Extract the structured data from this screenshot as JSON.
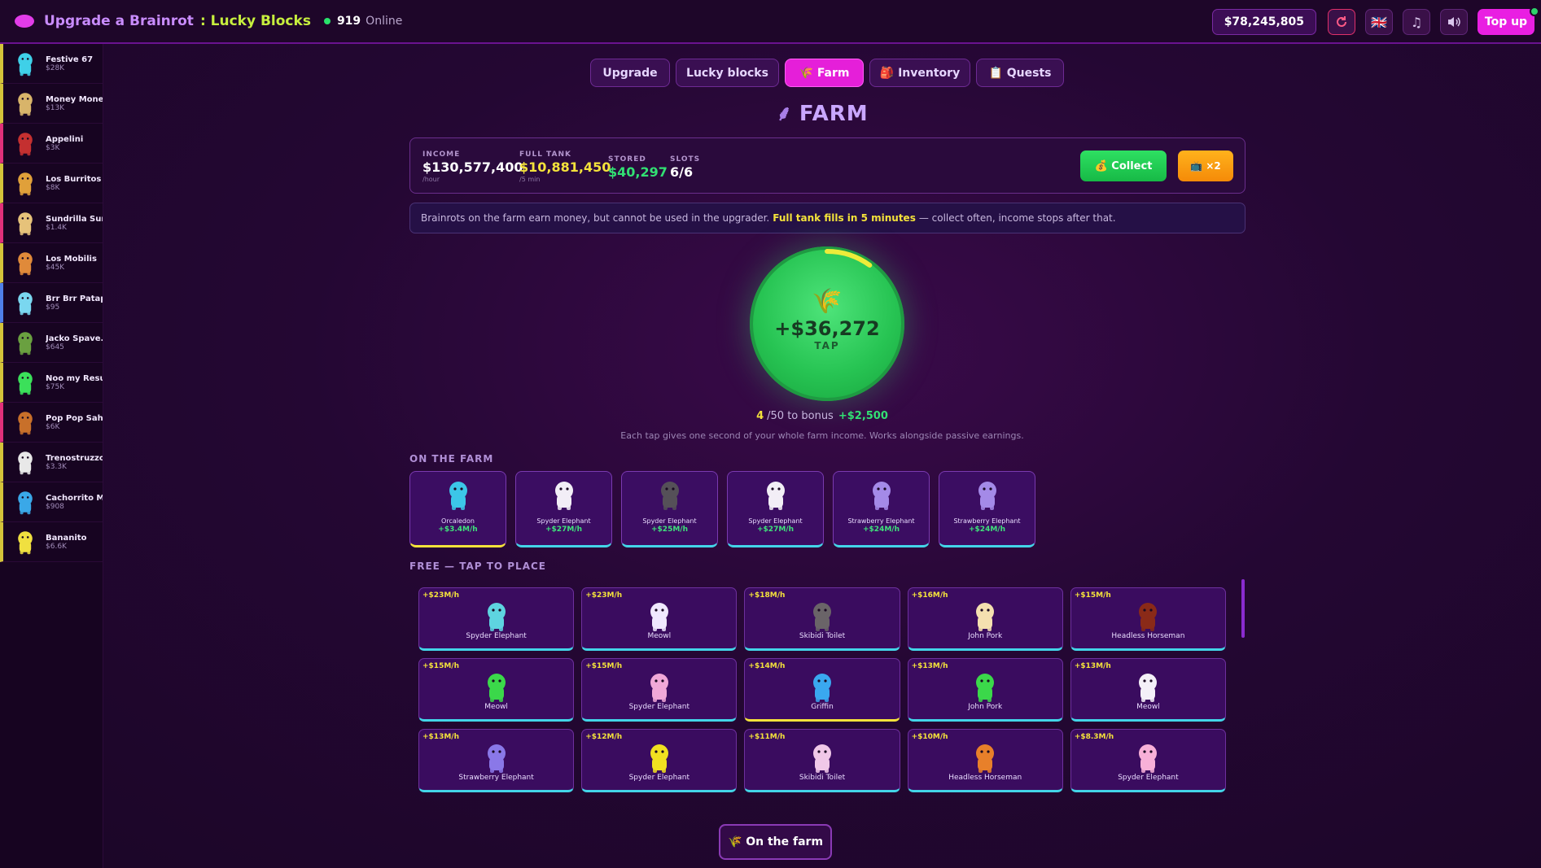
{
  "header": {
    "title": "Upgrade a Brainrot",
    "subtitle": ": Lucky Blocks",
    "online_count": "919",
    "online_label": "Online",
    "balance": "$78,245,805",
    "topup_label": "Top up",
    "flag": "🇬🇧",
    "icons": [
      "refresh-icon",
      "flag-uk-icon",
      "music-icon",
      "sound-icon"
    ]
  },
  "sidebar": {
    "items": [
      {
        "name": "Festive 67",
        "price": "$28K",
        "color": "#3fd0e8"
      },
      {
        "name": "Money Mone...",
        "price": "$13K",
        "color": "#d8b46a"
      },
      {
        "name": "Appelini",
        "price": "$3K",
        "color": "#c43030"
      },
      {
        "name": "Los Burritos",
        "price": "$8K",
        "color": "#e0a03a"
      },
      {
        "name": "Sundrilla Sun...",
        "price": "$1.4K",
        "color": "#e6c27a"
      },
      {
        "name": "Los Mobilis",
        "price": "$45K",
        "color": "#e08a3a"
      },
      {
        "name": "Brr Brr Patap...",
        "price": "$95",
        "color": "#7ad7f0"
      },
      {
        "name": "Jacko Spave...",
        "price": "$645",
        "color": "#6aa040"
      },
      {
        "name": "Noo my Resu...",
        "price": "$75K",
        "color": "#3be05a"
      },
      {
        "name": "Pop Pop Sahur",
        "price": "$6K",
        "color": "#c8702a"
      },
      {
        "name": "Trenostruzzo...",
        "price": "$3.3K",
        "color": "#e8e8e8"
      },
      {
        "name": "Cachorrito M...",
        "price": "$908",
        "color": "#3aa8e8"
      },
      {
        "name": "Bananito",
        "price": "$6.6K",
        "color": "#f0e040"
      }
    ]
  },
  "tabs": [
    {
      "label": "Upgrade",
      "icon": ""
    },
    {
      "label": "Lucky blocks",
      "icon": ""
    },
    {
      "label": "Farm",
      "icon": "🌾",
      "active": true
    },
    {
      "label": "Inventory",
      "icon": "🎒"
    },
    {
      "label": "Quests",
      "icon": "📋"
    }
  ],
  "farm": {
    "heading": "FARM",
    "stats": {
      "income_label": "INCOME",
      "income_value": "$130,577,400",
      "income_unit": "/hour",
      "tank_label": "FULL TANK",
      "tank_value": "$10,881,450",
      "tank_unit": "/5 min",
      "stored_label": "STORED",
      "stored_value": "$40,297",
      "slots_label": "SLOTS",
      "slots_value": "6/6"
    },
    "collect_label": "Collect",
    "collect_icon": "💰",
    "x2_label": "×2",
    "x2_icon": "📺",
    "info_prefix": "Brainrots on the farm earn money, but cannot be used in the upgrader.",
    "info_bold": "Full tank fills in 5 minutes",
    "info_suffix": "— collect often, income stops after that.",
    "tap_amount": "+$36,272",
    "tap_label": "TAP",
    "tap_progress": 0.1,
    "bonus_current": "4",
    "bonus_total": "/50 to bonus",
    "bonus_reward": "+$2,500",
    "bonus_note": "Each tap gives one second of your whole farm income. Works alongside passive earnings.",
    "on_farm_title": "ON THE FARM",
    "free_title": "FREE — TAP TO PLACE",
    "on_farm_button": "On the farm",
    "on_farm_button_icon": "🌾"
  },
  "on_farm": [
    {
      "name": "Orcaledon",
      "income": "+$3.4M/h",
      "color": "#3cc6e8",
      "gold": true
    },
    {
      "name": "Spyder Elephant",
      "income": "+$27M/h",
      "color": "#f2eef6"
    },
    {
      "name": "Spyder Elephant",
      "income": "+$25M/h",
      "color": "#555058"
    },
    {
      "name": "Spyder Elephant",
      "income": "+$27M/h",
      "color": "#f2eef6"
    },
    {
      "name": "Strawberry Elephant",
      "income": "+$24M/h",
      "color": "#a48ae8"
    },
    {
      "name": "Strawberry Elephant",
      "income": "+$24M/h",
      "color": "#a48ae8"
    }
  ],
  "free": [
    {
      "rate": "+$23M/h",
      "name": "Spyder Elephant",
      "color": "#5ed4e0"
    },
    {
      "rate": "+$23M/h",
      "name": "Meowl",
      "color": "#f0e8ff"
    },
    {
      "rate": "+$18M/h",
      "name": "Skibidi Toilet",
      "color": "#6a6468"
    },
    {
      "rate": "+$16M/h",
      "name": "John Pork",
      "color": "#f4e0b0"
    },
    {
      "rate": "+$15M/h",
      "name": "Headless Horseman",
      "color": "#8a2a18"
    },
    {
      "rate": "+$15M/h",
      "name": "Meowl",
      "color": "#3bd84a"
    },
    {
      "rate": "+$15M/h",
      "name": "Spyder Elephant",
      "color": "#f0a8d8"
    },
    {
      "rate": "+$14M/h",
      "name": "Griffin",
      "color": "#3aa8f0",
      "gold": true
    },
    {
      "rate": "+$13M/h",
      "name": "John Pork",
      "color": "#3bd84a"
    },
    {
      "rate": "+$13M/h",
      "name": "Meowl",
      "color": "#f4f0f8"
    },
    {
      "rate": "+$13M/h",
      "name": "Strawberry Elephant",
      "color": "#8a78e8"
    },
    {
      "rate": "+$12M/h",
      "name": "Spyder Elephant",
      "color": "#f0e020"
    },
    {
      "rate": "+$11M/h",
      "name": "Skibidi Toilet",
      "color": "#f0c8e8"
    },
    {
      "rate": "+$10M/h",
      "name": "Headless Horseman",
      "color": "#e8802a"
    },
    {
      "rate": "+$8.3M/h",
      "name": "Spyder Elephant",
      "color": "#f8b0d8"
    }
  ]
}
